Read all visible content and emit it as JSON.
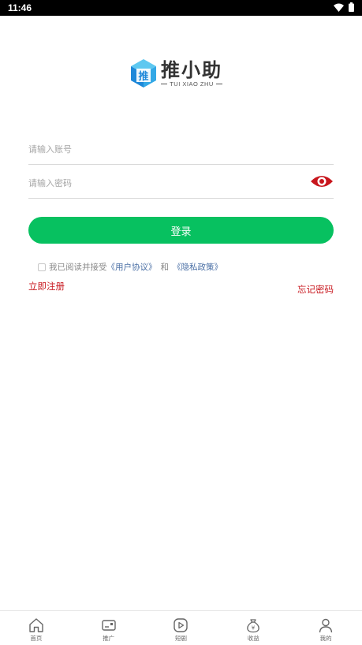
{
  "status_bar": {
    "time": "11:46",
    "icons": [
      "wifi-icon",
      "battery-icon"
    ]
  },
  "logo": {
    "title": "推小助",
    "subtitle": "TUI XIAO ZHU",
    "mark_icon": "cube-logo-icon",
    "mark_text": "推",
    "colors": {
      "cube_top": "#5ec8f0",
      "cube_left": "#1e88d9",
      "cube_right": "#33a8e6"
    }
  },
  "form": {
    "account_placeholder": "请输入账号",
    "account_value": "",
    "password_placeholder": "请输入密码",
    "password_value": "",
    "toggle_icon": "eye-icon",
    "login_label": "登录"
  },
  "agreement": {
    "prefix": "我已阅读并接受",
    "user_agreement": "《用户协议》",
    "connector": "和",
    "privacy_policy": "《隐私政策》",
    "checked": false
  },
  "links": {
    "register": "立即注册",
    "forgot": "忘记密码"
  },
  "tabbar": {
    "items": [
      {
        "label": "首页",
        "icon": "home-icon"
      },
      {
        "label": "推广",
        "icon": "promote-icon"
      },
      {
        "label": "短剧",
        "icon": "play-icon"
      },
      {
        "label": "收益",
        "icon": "money-bag-icon"
      },
      {
        "label": "我的",
        "icon": "user-icon"
      }
    ]
  },
  "colors": {
    "primary": "#07c160",
    "link_red": "#c8161d",
    "link_blue": "#4a6fa5",
    "eye_red": "#c8161d"
  }
}
